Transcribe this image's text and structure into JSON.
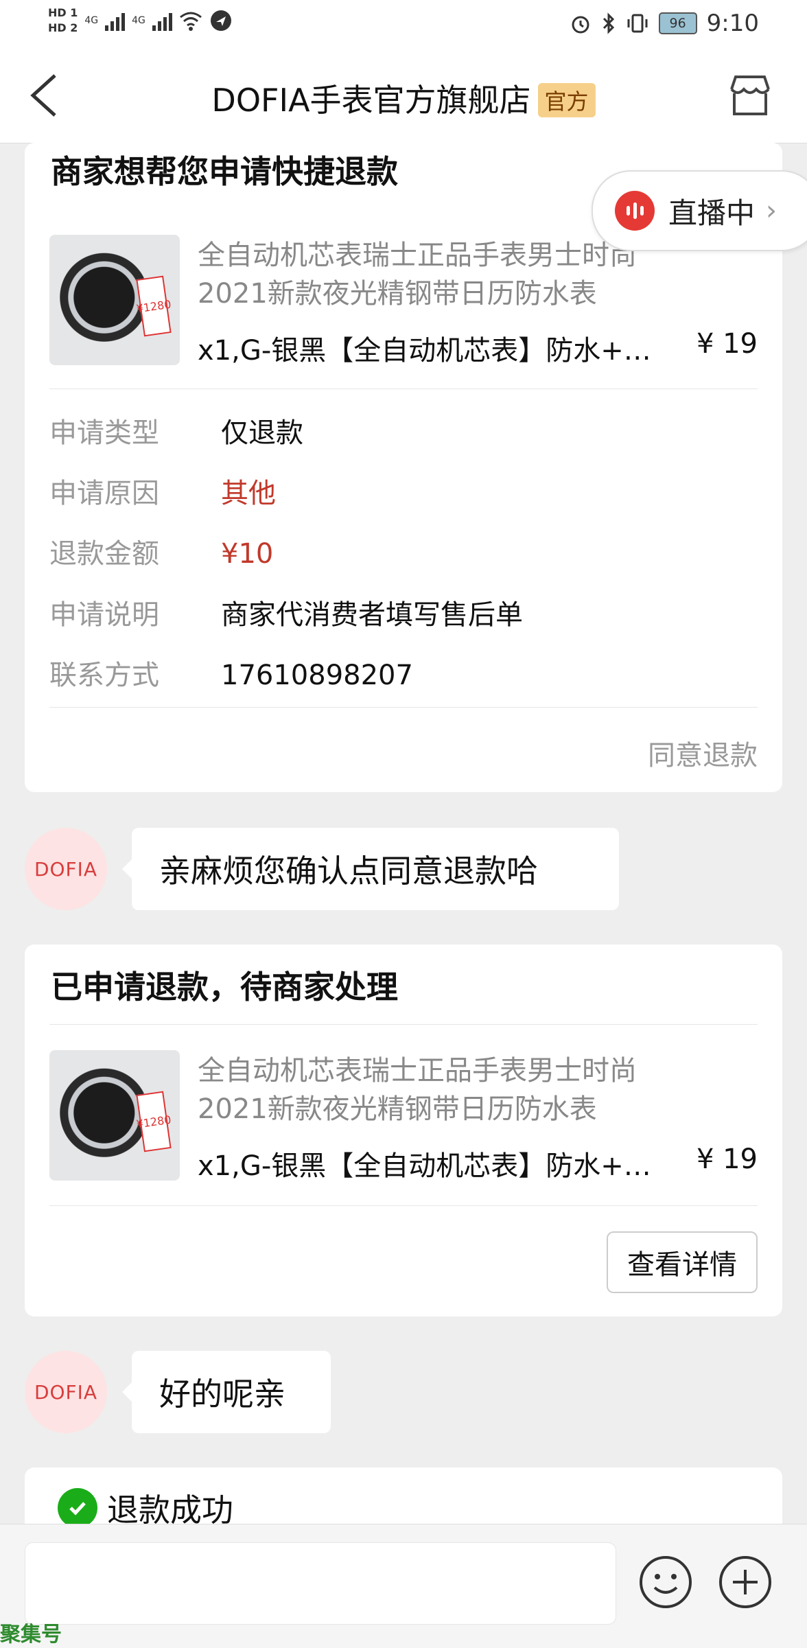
{
  "status": {
    "battery": "96",
    "time": "9:10",
    "hd1": "HD 1",
    "hd2": "HD 2",
    "net1": "4G",
    "net2": "4G"
  },
  "nav": {
    "title": "DOFIA手表官方旗舰店",
    "badge": "官方"
  },
  "live": {
    "label": "直播中"
  },
  "card1": {
    "title": "商家想帮您申请快捷退款",
    "product": {
      "name": "全自动机芯表瑞士正品手表男士时尚2021新款夜光精钢带日历防水表",
      "spec": "x1,G-银黑【全自动机芯表】防水+…",
      "price": "¥ 19",
      "tag": "¥1280"
    },
    "rows": [
      {
        "label": "申请类型",
        "value": "仅退款"
      },
      {
        "label": "申请原因",
        "value": "其他"
      },
      {
        "label": "退款金额",
        "value": "¥10"
      },
      {
        "label": "申请说明",
        "value": "商家代消费者填写售后单"
      },
      {
        "label": "联系方式",
        "value": "17610898207"
      }
    ],
    "action": "同意退款"
  },
  "chat": [
    {
      "avatar": "DOFIA",
      "text": "亲麻烦您确认点同意退款哈"
    },
    {
      "avatar": "DOFIA",
      "text": "好的呢亲"
    }
  ],
  "card2": {
    "title": "已申请退款，待商家处理",
    "product": {
      "name": "全自动机芯表瑞士正品手表男士时尚2021新款夜光精钢带日历防水表",
      "spec": "x1,G-银黑【全自动机芯表】防水+…",
      "price": "¥ 19",
      "tag": "¥1280"
    },
    "button": "查看详情"
  },
  "card3": {
    "status": "退款成功"
  },
  "watermark": "聚集号"
}
